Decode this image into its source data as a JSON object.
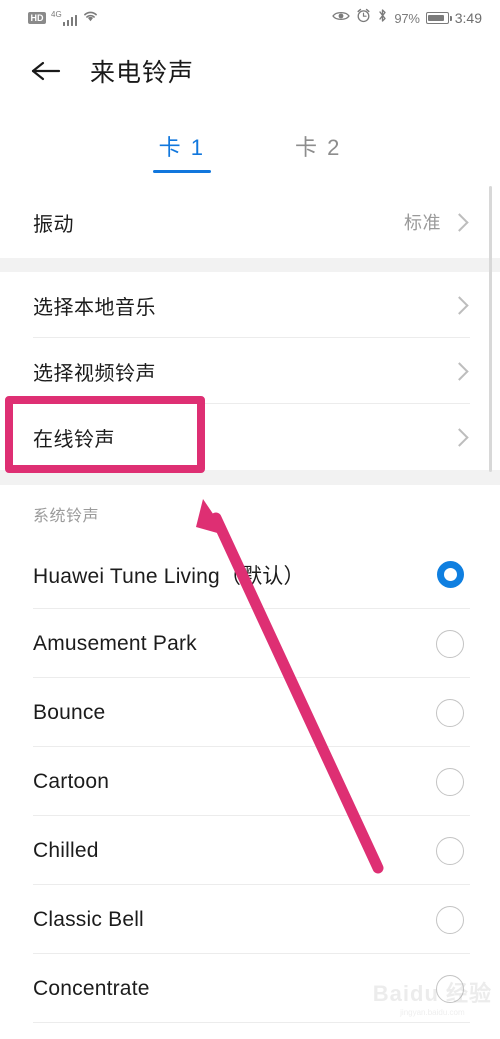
{
  "status_bar": {
    "hd_label": "HD",
    "network_label": "4G",
    "signal_icon": "signal-bars-icon",
    "wifi_icon": "wifi-icon",
    "eye_icon": "eye-icon",
    "alarm_icon": "alarm-clock-icon",
    "bluetooth_icon": "bluetooth-icon",
    "battery_percent": "97%",
    "battery_icon": "battery-icon",
    "time": "3:49"
  },
  "header": {
    "back_icon": "back-arrow-icon",
    "title": "来电铃声"
  },
  "tabs": [
    {
      "label": "卡 1",
      "active": true
    },
    {
      "label": "卡 2",
      "active": false
    }
  ],
  "sections": {
    "vibration": {
      "label": "振动",
      "value": "标准",
      "chevron_icon": "chevron-right-icon"
    },
    "sources": [
      {
        "label": "选择本地音乐",
        "chevron_icon": "chevron-right-icon"
      },
      {
        "label": "选择视频铃声",
        "chevron_icon": "chevron-right-icon"
      },
      {
        "label": "在线铃声",
        "chevron_icon": "chevron-right-icon",
        "highlighted": true
      }
    ],
    "system_tones": {
      "header": "系统铃声",
      "items": [
        {
          "label": "Huawei Tune Living（默认）",
          "selected": true
        },
        {
          "label": "Amusement Park",
          "selected": false
        },
        {
          "label": "Bounce",
          "selected": false
        },
        {
          "label": "Cartoon",
          "selected": false
        },
        {
          "label": "Chilled",
          "selected": false
        },
        {
          "label": "Classic Bell",
          "selected": false
        },
        {
          "label": "Concentrate",
          "selected": false
        }
      ]
    }
  },
  "annotations": {
    "highlight_color": "#de2f73",
    "arrow_color": "#de2f73",
    "highlight_target": "在线铃声",
    "arrow_points_to": "在线铃声"
  },
  "watermark": {
    "text": "Baidu 经验",
    "sub": "jingyan.baidu.com"
  },
  "colors": {
    "accent_blue": "#1177dd",
    "selected_radio": "#0f7fe0",
    "annotation_pink": "#de2f73",
    "background": "#ffffff",
    "section_gap": "#f2f2f2"
  }
}
